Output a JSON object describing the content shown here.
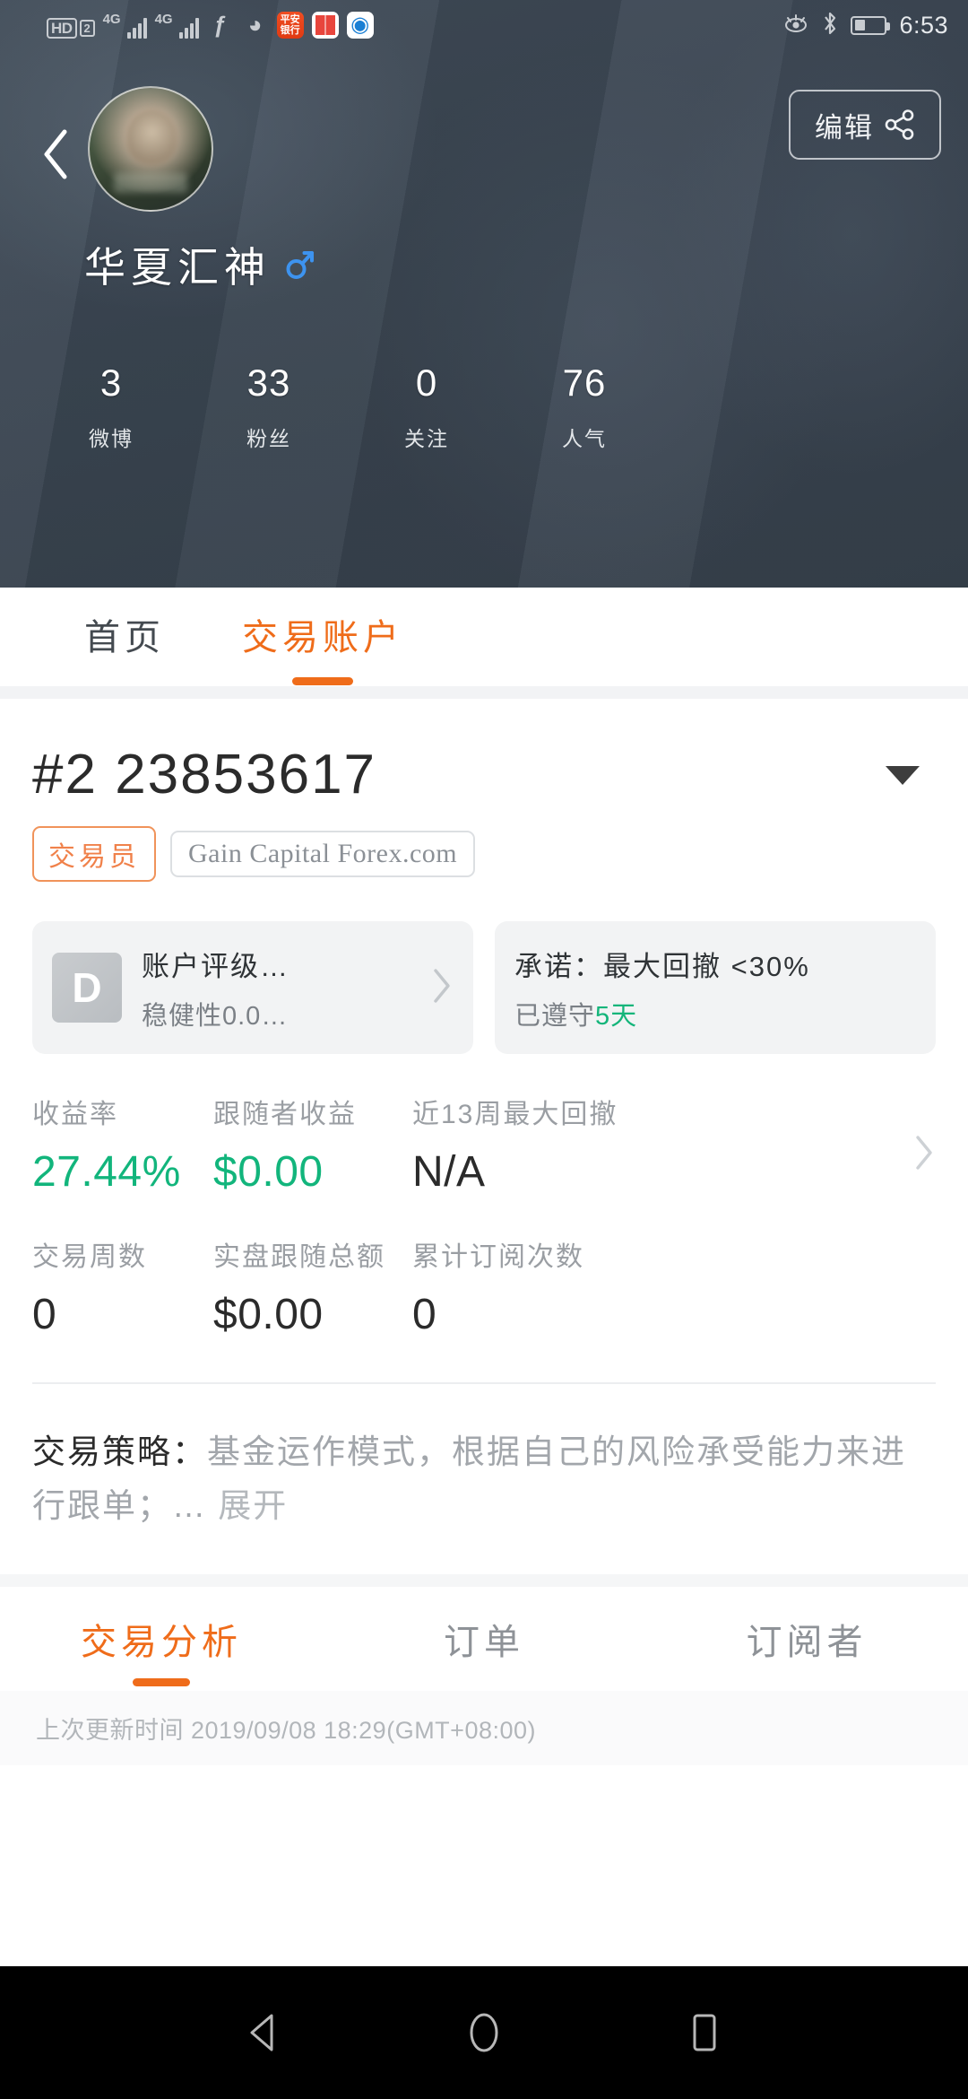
{
  "status_bar": {
    "hd_label": "HD",
    "sim_badge": "2",
    "network1": "4G",
    "network2": "4G",
    "app_icons": [
      {
        "name": "fuiou-icon",
        "glyph": "ƒ"
      },
      {
        "name": "wechat-icon",
        "glyph": "◕"
      },
      {
        "name": "pingan-bank-icon",
        "glyph": "平安银行"
      },
      {
        "name": "book-reader-icon",
        "glyph": ""
      },
      {
        "name": "browser-globe-icon",
        "glyph": "◐"
      }
    ],
    "eye_comfort_icon": "◉",
    "bluetooth_icon": "ᛦ",
    "battery_level": 36,
    "time": "6:53"
  },
  "header": {
    "back_label": "‹",
    "edit_button": "编辑",
    "username": "华夏汇神",
    "gender": "male",
    "stats": [
      {
        "value": "3",
        "label": "微博"
      },
      {
        "value": "33",
        "label": "粉丝"
      },
      {
        "value": "0",
        "label": "关注"
      },
      {
        "value": "76",
        "label": "人气"
      }
    ]
  },
  "top_tabs": [
    {
      "label": "首页",
      "active": false
    },
    {
      "label": "交易账户",
      "active": true
    }
  ],
  "account": {
    "number": "#2 23853617",
    "role_badge": "交易员",
    "broker": "Gain Capital Forex.com"
  },
  "cards": {
    "rating": {
      "grade": "D",
      "title": "账户评级…",
      "subtitle": "稳健性0.0…"
    },
    "promise": {
      "title": "承诺：最大回撤 <30%",
      "prefix": "已遵守",
      "days": "5天"
    }
  },
  "metrics": {
    "row1": [
      {
        "label": "收益率",
        "value": "27.44%",
        "color": "green"
      },
      {
        "label": "跟随者收益",
        "value": "$0.00",
        "color": "green"
      },
      {
        "label": "近13周最大回撤",
        "value": "N/A",
        "color": "dark"
      }
    ],
    "row2": [
      {
        "label": "交易周数",
        "value": "0",
        "color": "dark"
      },
      {
        "label": "实盘跟随总额",
        "value": "$0.00",
        "color": "dark"
      },
      {
        "label": "累计订阅次数",
        "value": "0",
        "color": "dark"
      }
    ]
  },
  "strategy": {
    "label": "交易策略：",
    "text": "基金运作模式，根据自己的风险承受能力来进行跟单；…",
    "expand": "展开"
  },
  "bottom_tabs": [
    {
      "label": "交易分析",
      "active": true
    },
    {
      "label": "订单",
      "active": false
    },
    {
      "label": "订阅者",
      "active": false
    }
  ],
  "footer": {
    "updated": "上次更新时间 2019/09/08 18:29(GMT+08:00)"
  },
  "nav_bar": {
    "back": "back-triangle",
    "home": "home-circle",
    "recents": "recents-square"
  },
  "colors": {
    "accent_orange": "#ef6c1a",
    "green": "#12b57c",
    "header_bg": "#3a4551"
  }
}
